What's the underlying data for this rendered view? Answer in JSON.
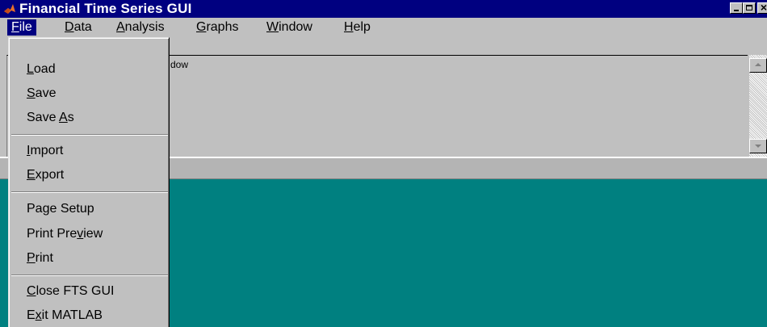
{
  "window": {
    "title": "Financial Time Series GUI",
    "icon": "matlab-logo-icon",
    "controls": {
      "minimize": "minimize-icon",
      "maximize": "maximize-icon",
      "close": "×"
    }
  },
  "menubar": {
    "items": [
      {
        "pre": "",
        "key": "F",
        "post": "ile",
        "active": true
      },
      {
        "pre": "",
        "key": "D",
        "post": "ata",
        "active": false
      },
      {
        "pre": "",
        "key": "A",
        "post": "nalysis",
        "active": false
      },
      {
        "pre": "",
        "key": "G",
        "post": "raphs",
        "active": false
      },
      {
        "pre": "",
        "key": "W",
        "post": "indow",
        "active": false
      },
      {
        "pre": "",
        "key": "H",
        "post": "elp",
        "active": false
      }
    ]
  },
  "command_window": {
    "visible_text": "dow"
  },
  "file_menu": {
    "items": [
      {
        "pre": "",
        "key": "L",
        "post": "oad"
      },
      {
        "pre": "",
        "key": "S",
        "post": "ave"
      },
      {
        "pre": "Save ",
        "key": "A",
        "post": "s"
      },
      {
        "pre": "",
        "key": "I",
        "post": "mport"
      },
      {
        "pre": "",
        "key": "E",
        "post": "xport"
      },
      {
        "pre": "Pa",
        "key": "g",
        "post": "e Setup"
      },
      {
        "pre": "Print Pre",
        "key": "v",
        "post": "iew"
      },
      {
        "pre": "",
        "key": "P",
        "post": "rint"
      },
      {
        "pre": "",
        "key": "C",
        "post": "lose FTS GUI"
      },
      {
        "pre": "E",
        "key": "x",
        "post": "it MATLAB"
      }
    ]
  },
  "colors": {
    "titlebar": "#000080",
    "menu_highlight": "#000080",
    "workspace": "#008080",
    "face": "#c0c0c0"
  }
}
